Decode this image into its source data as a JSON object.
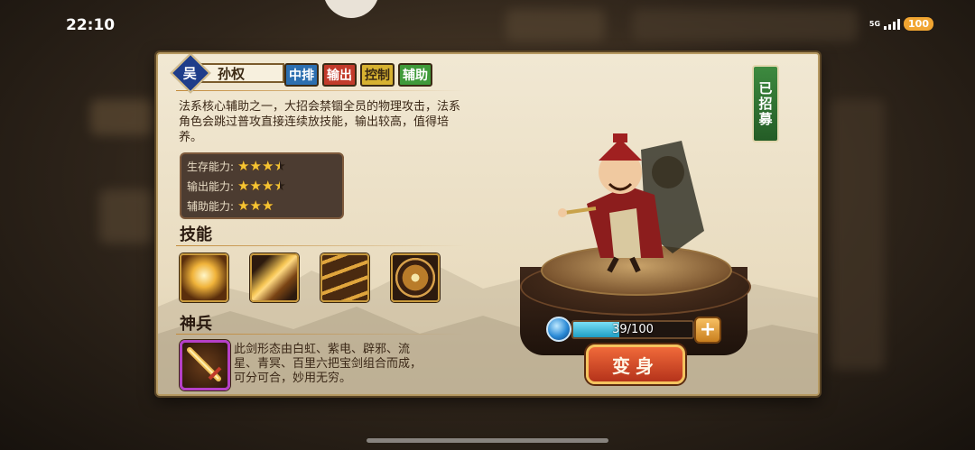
{
  "status_bar": {
    "time": "22:10",
    "network": "5G",
    "battery": "100"
  },
  "hero": {
    "faction": "吴",
    "name": "孙权",
    "tags": [
      {
        "label": "中排",
        "color": "#2c6fb0"
      },
      {
        "label": "输出",
        "color": "#c23b2b"
      },
      {
        "label": "控制",
        "color": "#d7b231"
      },
      {
        "label": "辅助",
        "color": "#3f9a3a"
      }
    ],
    "description": "法系核心辅助之一，大招会禁锢全员的物理攻击，法系角色会跳过普攻直接连续放技能，输出较高，值得培养。",
    "stats": [
      {
        "label": "生存能力:",
        "rating": 3.5
      },
      {
        "label": "输出能力:",
        "rating": 3.5
      },
      {
        "label": "辅助能力:",
        "rating": 3
      }
    ],
    "status": "已招募"
  },
  "skills": {
    "title": "技能",
    "items": [
      {
        "icon": "light-burst-skill-icon"
      },
      {
        "icon": "sword-slash-skill-icon"
      },
      {
        "icon": "chain-skill-icon"
      },
      {
        "icon": "shield-sword-skill-icon"
      }
    ]
  },
  "divine_weapon": {
    "title": "神兵",
    "icon": "sword-weapon-icon",
    "description": "此剑形态由白虹、紫电、辟邪、流星、青冥、百里六把宝剑组合而成，可分可合，妙用无穷。"
  },
  "progress": {
    "current": 39,
    "max": 100,
    "text": "39/100"
  },
  "actions": {
    "plus": "+",
    "transform": "变身"
  }
}
